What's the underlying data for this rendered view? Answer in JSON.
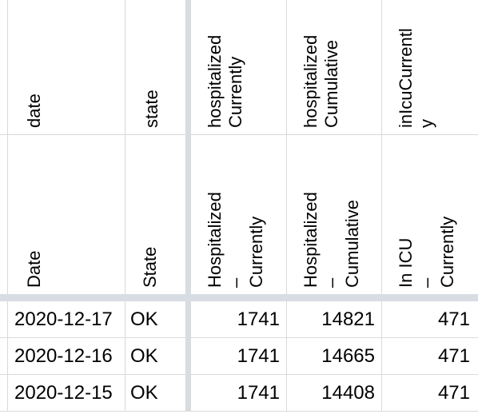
{
  "header_row_1": {
    "date": "date",
    "state": "state",
    "hospitalized_currently": "hospitalized\nCurrently",
    "hospitalized_cumulative": "hospitalized\nCumulative",
    "inicu_currently": "inIcuCurrentl\ny"
  },
  "header_row_2": {
    "date": "Date",
    "state": "State",
    "hospitalized_currently": "Hospitalized –\nCurrently",
    "hospitalized_cumulative": "Hospitalized –\nCumulative",
    "inicu_currently": "In ICU\n– Currently"
  },
  "rows": [
    {
      "date": "2020-12-17",
      "state": "OK",
      "hospitalized_currently": "1741",
      "hospitalized_cumulative": "14821",
      "inicu_currently": "471"
    },
    {
      "date": "2020-12-16",
      "state": "OK",
      "hospitalized_currently": "1741",
      "hospitalized_cumulative": "14665",
      "inicu_currently": "471"
    },
    {
      "date": "2020-12-15",
      "state": "OK",
      "hospitalized_currently": "1741",
      "hospitalized_cumulative": "14408",
      "inicu_currently": "471"
    }
  ]
}
